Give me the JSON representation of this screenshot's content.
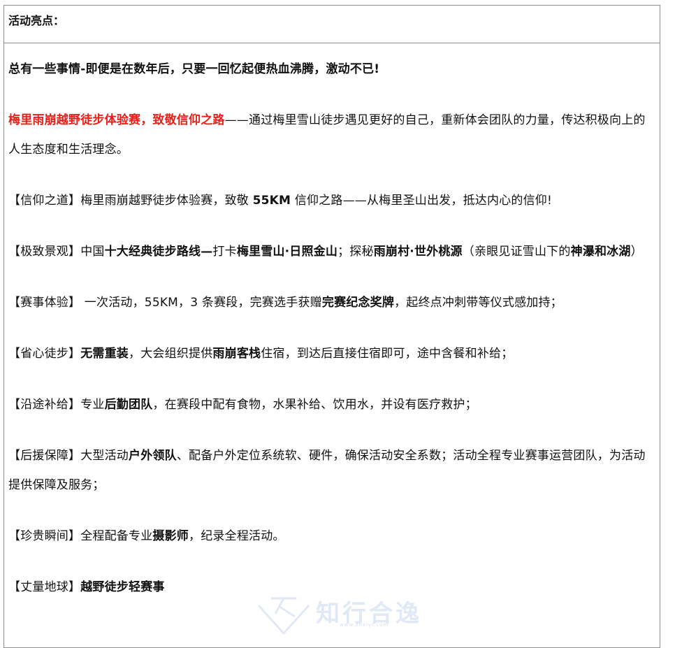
{
  "header": {
    "title": "活动亮点："
  },
  "paragraphs": [
    [
      {
        "t": "总有一些事情-即便是在数年后，只要一回忆起便热血沸腾，激动不已!",
        "s": "b"
      }
    ],
    [
      {
        "t": "梅里雨崩越野徒步体验赛，致敬信仰之路",
        "s": "red"
      },
      {
        "t": "——通过梅里雪山徒步遇见更好的自己，重新体会团队的力量，传达积极向上的人生态度和生活理念。",
        "s": ""
      }
    ],
    [
      {
        "t": "【信仰之道】梅里雨崩越野徒步体验赛，致敬 ",
        "s": ""
      },
      {
        "t": "55KM",
        "s": "b"
      },
      {
        "t": " 信仰之路——从梅里圣山出发，抵达内心的信仰!",
        "s": ""
      }
    ],
    [
      {
        "t": "【极致景观】中国",
        "s": ""
      },
      {
        "t": "十大经典徒步路线—",
        "s": "b"
      },
      {
        "t": "打卡",
        "s": ""
      },
      {
        "t": "梅里雪山·日照金山",
        "s": "b"
      },
      {
        "t": "；探秘",
        "s": ""
      },
      {
        "t": "雨崩村·世外桃源",
        "s": "b"
      },
      {
        "t": "（亲眼见证雪山下的",
        "s": ""
      },
      {
        "t": "神瀑和冰湖",
        "s": "b"
      },
      {
        "t": "）",
        "s": ""
      }
    ],
    [
      {
        "t": "【赛事体验】 一次活动，55KM，3 条赛段，完赛选手获赠",
        "s": ""
      },
      {
        "t": "完赛纪念奖牌",
        "s": "b"
      },
      {
        "t": "，起终点冲刺带等仪式感加持；",
        "s": ""
      }
    ],
    [
      {
        "t": "【省心徒步】",
        "s": ""
      },
      {
        "t": "无需重装",
        "s": "b"
      },
      {
        "t": "，大会组织提供",
        "s": ""
      },
      {
        "t": "雨崩客栈",
        "s": "b"
      },
      {
        "t": "住宿，到达后直接住宿即可，途中含餐和补给；",
        "s": ""
      }
    ],
    [
      {
        "t": "【沿途补给】专业",
        "s": ""
      },
      {
        "t": "后勤团队",
        "s": "b"
      },
      {
        "t": "，在赛段中配有食物，水果补给、饮用水，并设有医疗救护；",
        "s": ""
      }
    ],
    [
      {
        "t": "【后援保障】大型活动",
        "s": ""
      },
      {
        "t": "户外领队",
        "s": "b"
      },
      {
        "t": "、配备户外定位系统软、硬件，确保活动安全系数；活动全程专业赛事运营团队，为活动提供保障及服务；",
        "s": ""
      }
    ],
    [
      {
        "t": "【珍贵瞬间】全程配备专业",
        "s": ""
      },
      {
        "t": "摄影师",
        "s": "b"
      },
      {
        "t": "，纪录全程活动。",
        "s": ""
      }
    ],
    [
      {
        "t": "【丈量地球】",
        "s": ""
      },
      {
        "t": "越野徒步轻赛事",
        "s": "b"
      }
    ]
  ],
  "watermark": {
    "text": "知行合逸",
    "url": "www.zhxiyi.com",
    "color": "#c9d7ef"
  }
}
